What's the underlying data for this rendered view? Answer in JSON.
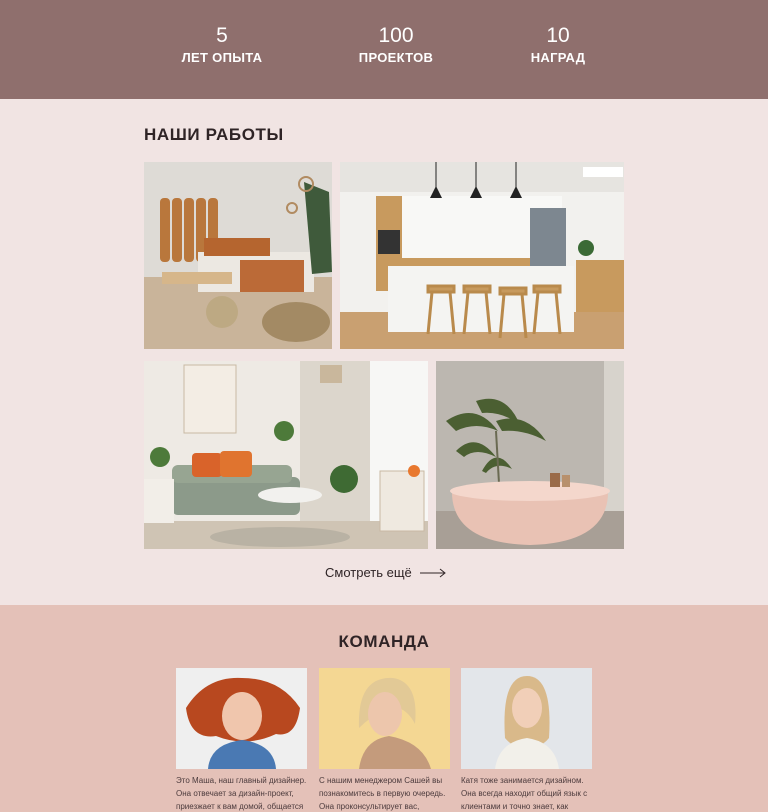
{
  "stats": [
    {
      "number": "5",
      "label": "ЛЕТ ОПЫТА"
    },
    {
      "number": "100",
      "label": "ПРОЕКТОВ"
    },
    {
      "number": "10",
      "label": "НАГРАД"
    }
  ],
  "works": {
    "title": "НАШИ РАБОТЫ",
    "photos": [
      {
        "name": "bedroom"
      },
      {
        "name": "kitchen"
      },
      {
        "name": "living-room"
      },
      {
        "name": "bathroom"
      }
    ],
    "more_label": "Смотреть ещё"
  },
  "team": {
    "title": "КОМАНДА",
    "members": [
      {
        "desc": "Это Маша, наш главный дизайнер. Она отвечает за дизайн-проект, приезжает к вам домой, общается"
      },
      {
        "desc": "С нашим менеджером Сашей вы познакомитесь в первую очередь. Она проконсультирует вас,"
      },
      {
        "desc": "Катя тоже занимается дизайном. Она всегда находит общий язык с клиентами и точно знает, как"
      }
    ]
  },
  "colors": {
    "stats_bg": "#8f6f6d",
    "works_bg": "#f1e4e3",
    "team_bg": "#e4c1b8"
  }
}
